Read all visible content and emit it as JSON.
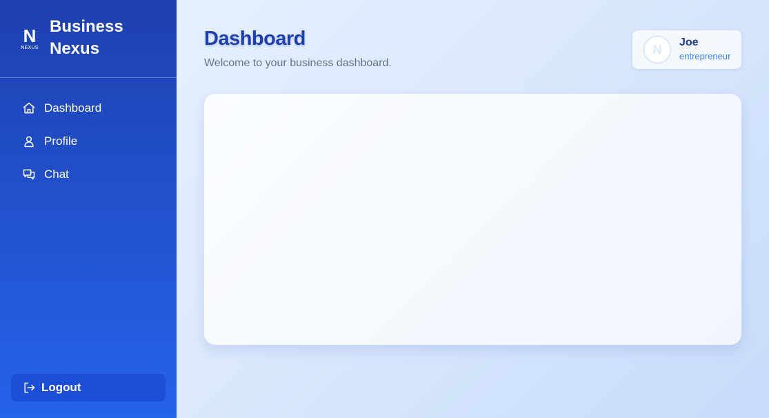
{
  "brand": {
    "logo_letter": "N",
    "logo_sub": "NEXUS",
    "name_line1": "Business",
    "name_line2": "Nexus"
  },
  "sidebar": {
    "items": [
      {
        "label": "Dashboard",
        "icon": "home-icon"
      },
      {
        "label": "Profile",
        "icon": "user-icon"
      },
      {
        "label": "Chat",
        "icon": "chat-icon"
      }
    ],
    "logout_label": "Logout"
  },
  "header": {
    "title": "Dashboard",
    "subtitle": "Welcome to your business dashboard."
  },
  "user": {
    "name": "Joe",
    "role": "entrepreneur",
    "avatar_letter": "N"
  },
  "colors": {
    "sidebar_top": "#1e40af",
    "sidebar_bottom": "#2563eb",
    "title": "#1e40af",
    "logout_bg": "#1d4ed8",
    "role_text": "#3b82f6"
  }
}
